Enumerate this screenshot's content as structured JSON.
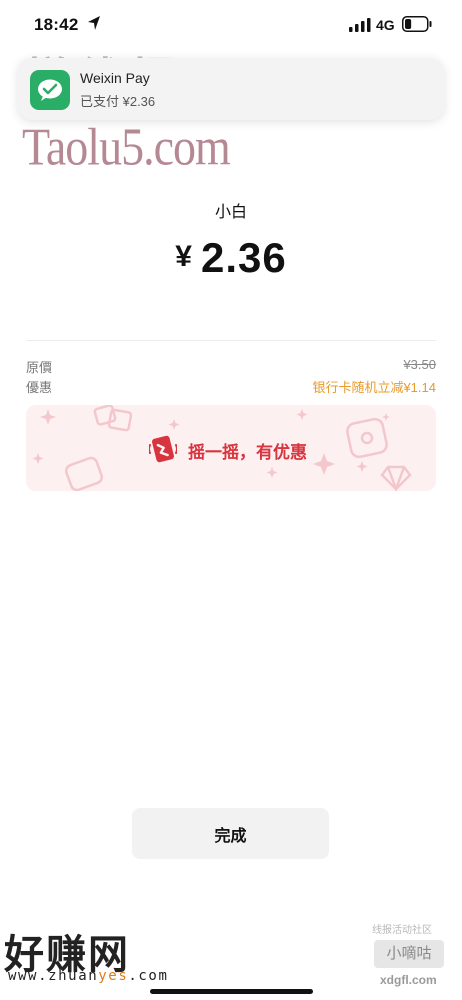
{
  "status_bar": {
    "time": "18:42",
    "network": "4G",
    "battery_level": 0.3
  },
  "notification": {
    "app_name": "Weixin Pay",
    "message": "已支付 ¥2.36",
    "icon": "wechat-pay-icon",
    "icon_color": "#2aae67"
  },
  "watermarks": {
    "top_cn": "搓线报",
    "top_url": "Taolu5.com",
    "bottom_left_cn": "好赚网",
    "bottom_left_url_prefix": "www.zhuan",
    "bottom_left_url_highlight": "yes",
    "bottom_left_url_suffix": ".com",
    "bottom_right_top": "线报活动社区",
    "bottom_right_box": "小嘀咕",
    "bottom_right_url": "xdgfl.com"
  },
  "payment": {
    "merchant": "小白",
    "currency_symbol": "¥",
    "amount": "2.36",
    "original_label": "原價",
    "original_value": "¥3.50",
    "discount_label": "優惠",
    "discount_value": "银行卡随机立减¥1.14"
  },
  "promo": {
    "text": "摇一摇，有优惠",
    "accent_color": "#d8343f"
  },
  "actions": {
    "done_label": "完成"
  },
  "colors": {
    "discount": "#e89a2a",
    "promo_bg": "#fdf0f0"
  }
}
